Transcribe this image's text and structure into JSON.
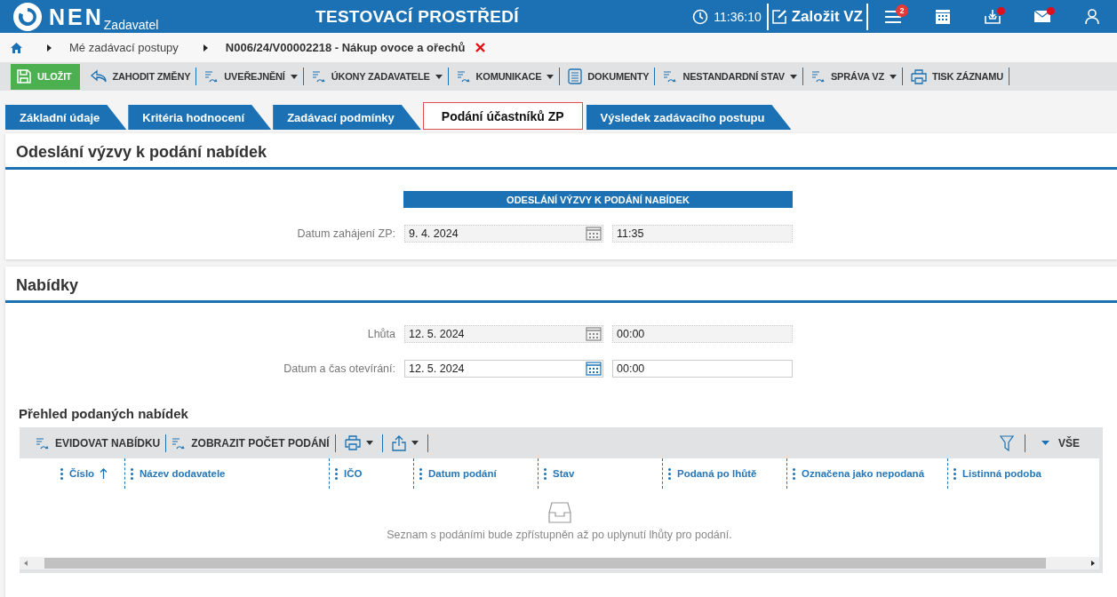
{
  "header": {
    "logo_text": "NEN",
    "logo_sub": "Zadavatel",
    "env_title": "TESTOVACÍ PROSTŘEDÍ",
    "time": "11:36:10",
    "create_label": "Založit VZ",
    "menu_badge": "2",
    "inbox_alert": true,
    "mail_alert": true
  },
  "breadcrumb": {
    "items": [
      {
        "label": "Mé zadávací postupy",
        "current": false
      },
      {
        "label": "N006/24/V00002218 - Nákup ovoce a ořechů",
        "current": true
      }
    ],
    "closable": true
  },
  "toolbar": [
    {
      "label": "ULOŽIT",
      "kind": "save",
      "dropdown": false
    },
    {
      "label": "ZAHODIT ZMĚNY",
      "kind": "undo",
      "dropdown": false
    },
    {
      "label": "UVEŘEJNĚNÍ",
      "kind": "flow",
      "dropdown": true
    },
    {
      "label": "ÚKONY ZADAVATELE",
      "kind": "flow",
      "dropdown": true
    },
    {
      "label": "KOMUNIKACE",
      "kind": "flow",
      "dropdown": true
    },
    {
      "label": "DOKUMENTY",
      "kind": "doc",
      "dropdown": false
    },
    {
      "label": "NESTANDARDNÍ STAV",
      "kind": "flow",
      "dropdown": true
    },
    {
      "label": "SPRÁVA VZ",
      "kind": "flow",
      "dropdown": true
    },
    {
      "label": "TISK ZÁZNAMU",
      "kind": "print",
      "dropdown": false
    }
  ],
  "tabs": [
    {
      "label": "Základní údaje",
      "selected": false
    },
    {
      "label": "Kritéria hodnocení",
      "selected": false
    },
    {
      "label": "Zadávací podmínky",
      "selected": false
    },
    {
      "label": "Podání účastníků ZP",
      "selected": true
    },
    {
      "label": "Výsledek zadávacího postupu",
      "selected": false
    }
  ],
  "sections": [
    {
      "title": "Odeslání výzvy k podání nabídek",
      "bar_title": "ODESLÁNÍ VÝZVY K PODÁNÍ NABÍDEK",
      "fields": [
        {
          "label": "Datum zahájení ZP:",
          "date": "9. 4. 2024",
          "time": "11:35",
          "editable": false
        }
      ]
    },
    {
      "title": "Nabídky",
      "fields": [
        {
          "label": "Lhůta",
          "date": "12. 5. 2024",
          "time": "00:00",
          "editable": false
        },
        {
          "label": "Datum a čas otevírání:",
          "date": "12. 5. 2024",
          "time": "00:00",
          "editable": true
        }
      ]
    }
  ],
  "offers_table": {
    "title": "Přehled podaných nabídek",
    "actions": [
      {
        "label": "EVIDOVAT NABÍDKU",
        "kind": "text"
      },
      {
        "label": "ZOBRAZIT POČET PODÁNÍ",
        "kind": "text"
      },
      {
        "kind": "print"
      },
      {
        "kind": "export"
      }
    ],
    "filter_label": "VŠE",
    "columns": [
      {
        "label": "Číslo",
        "sorted": true
      },
      {
        "label": "Název dodavatele",
        "sorted": false
      },
      {
        "label": "IČO",
        "sorted": false
      },
      {
        "label": "Datum podání",
        "sorted": false
      },
      {
        "label": "Stav",
        "sorted": false
      },
      {
        "label": "Podaná po lhůtě",
        "sorted": false
      },
      {
        "label": "Označena jako nepodaná",
        "sorted": false
      },
      {
        "label": "Listinná podoba",
        "sorted": false
      }
    ],
    "empty_message": "Seznam s podáními bude zpřístupněn až po uplynutí lhůty pro podání."
  }
}
